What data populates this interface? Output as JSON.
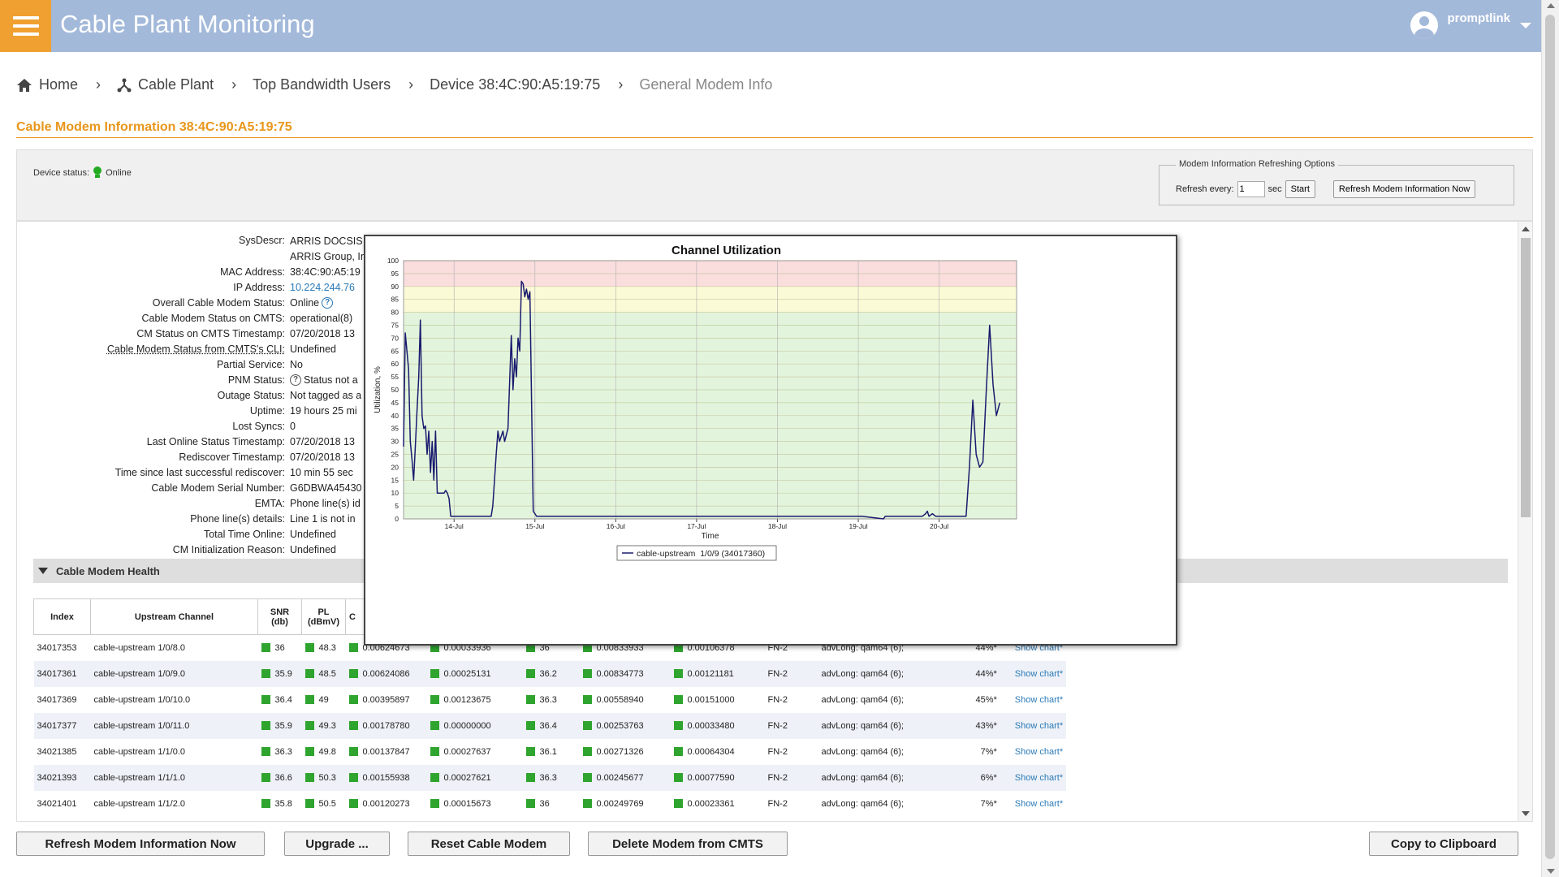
{
  "app": {
    "title": "Cable Plant Monitoring",
    "user": "promptlink"
  },
  "breadcrumb": {
    "home": "Home",
    "cable_plant": "Cable Plant",
    "top_users": "Top Bandwidth Users",
    "device": "Device 38:4C:90:A5:19:75",
    "current": "General Modem Info"
  },
  "section_title": "Cable Modem Information 38:4C:90:A5:19:75",
  "status": {
    "label": "Device status:",
    "value": "Online"
  },
  "refresh_options": {
    "legend": "Modem Information Refreshing Options",
    "every_label": "Refresh every:",
    "every_value": "1",
    "unit": "sec",
    "start_label": "Start",
    "refresh_now_label": "Refresh Modem Information Now"
  },
  "info": [
    {
      "label": "SysDescr:",
      "value": "ARRIS DOCSIS",
      "value2": "ARRIS Group, In"
    },
    {
      "label": "MAC Address:",
      "value": "38:4C:90:A5:19"
    },
    {
      "label": "IP Address:",
      "value": "10.224.244.76"
    },
    {
      "label": "Overall Cable Modem Status:",
      "value": "Online"
    },
    {
      "label": "Cable Modem Status on CMTS:",
      "value": "operational(8)"
    },
    {
      "label": "CM Status on CMTS Timestamp:",
      "value": "07/20/2018 13"
    },
    {
      "label": "Cable Modem Status from CMTS's CLI:",
      "value": "Undefined"
    },
    {
      "label": "Partial Service:",
      "value": "No"
    },
    {
      "label": "PNM Status:",
      "value": "Status not a"
    },
    {
      "label": "Outage Status:",
      "value": "Not tagged as a"
    },
    {
      "label": "Uptime:",
      "value": "19 hours 25 mi"
    },
    {
      "label": "Lost Syncs:",
      "value": "0"
    },
    {
      "label": "Last Online Status Timestamp:",
      "value": "07/20/2018 13"
    },
    {
      "label": "Rediscover Timestamp:",
      "value": "07/20/2018 13"
    },
    {
      "label": "Time since last successful rediscover:",
      "value": "10 min 55 sec"
    },
    {
      "label": "Cable Modem Serial Number:",
      "value": "G6DBWA45430"
    },
    {
      "label": "EMTA:",
      "value": "Phone line(s) id"
    },
    {
      "label": "Phone line(s) details:",
      "value": "Line 1 is not in"
    },
    {
      "label": "Total Time Online:",
      "value": "Undefined"
    },
    {
      "label": "CM Initialization Reason:",
      "value": "Undefined"
    }
  ],
  "health": {
    "title": "Cable Modem Health"
  },
  "upstream_table": {
    "headers": {
      "index": "Index",
      "channel": "Upstream Channel",
      "snr": "SNR",
      "snr_unit": "(db)",
      "pl": "PL",
      "pl_unit": "(dBmV)",
      "c": "C"
    },
    "rows": [
      {
        "index": "34017353",
        "channel": "cable-upstream 1/0/8.0",
        "snr": "36",
        "pl": "48.3",
        "c1": "0.00624673",
        "c2": "0.00033936",
        "c3": "36",
        "c4": "0.00833933",
        "c5": "0.00106378",
        "fn": "FN-2",
        "mod": "advLong: qam64 (6);",
        "util": "44%*",
        "link": "Show chart*"
      },
      {
        "index": "34017361",
        "channel": "cable-upstream 1/0/9.0",
        "snr": "35.9",
        "pl": "48.5",
        "c1": "0.00624086",
        "c2": "0.00025131",
        "c3": "36.2",
        "c4": "0.00834773",
        "c5": "0.00121181",
        "fn": "FN-2",
        "mod": "advLong: qam64 (6);",
        "util": "44%*",
        "link": "Show chart*"
      },
      {
        "index": "34017369",
        "channel": "cable-upstream 1/0/10.0",
        "snr": "36.4",
        "pl": "49",
        "c1": "0.00395897",
        "c2": "0.00123675",
        "c3": "36.3",
        "c4": "0.00558940",
        "c5": "0.00151000",
        "fn": "FN-2",
        "mod": "advLong: qam64 (6);",
        "util": "45%*",
        "link": "Show chart*"
      },
      {
        "index": "34017377",
        "channel": "cable-upstream 1/0/11.0",
        "snr": "35.9",
        "pl": "49.3",
        "c1": "0.00178780",
        "c2": "0.00000000",
        "c3": "36.4",
        "c4": "0.00253763",
        "c5": "0.00033480",
        "fn": "FN-2",
        "mod": "advLong: qam64 (6);",
        "util": "43%*",
        "link": "Show chart*"
      },
      {
        "index": "34021385",
        "channel": "cable-upstream 1/1/0.0",
        "snr": "36.3",
        "pl": "49.8",
        "c1": "0.00137847",
        "c2": "0.00027637",
        "c3": "36.1",
        "c4": "0.00271326",
        "c5": "0.00064304",
        "fn": "FN-2",
        "mod": "advLong: qam64 (6);",
        "util": "7%*",
        "link": "Show chart*"
      },
      {
        "index": "34021393",
        "channel": "cable-upstream 1/1/1.0",
        "snr": "36.6",
        "pl": "50.3",
        "c1": "0.00155938",
        "c2": "0.00027621",
        "c3": "36.3",
        "c4": "0.00245677",
        "c5": "0.00077590",
        "fn": "FN-2",
        "mod": "advLong: qam64 (6);",
        "util": "6%*",
        "link": "Show chart*"
      },
      {
        "index": "34021401",
        "channel": "cable-upstream 1/1/2.0",
        "snr": "35.8",
        "pl": "50.5",
        "c1": "0.00120273",
        "c2": "0.00015673",
        "c3": "36",
        "c4": "0.00249769",
        "c5": "0.00023361",
        "fn": "FN-2",
        "mod": "advLong: qam64 (6);",
        "util": "7%*",
        "link": "Show chart*"
      }
    ]
  },
  "buttons": {
    "refresh": "Refresh Modem Information Now",
    "upgrade": "Upgrade ...",
    "reset": "Reset Cable Modem",
    "delete": "Delete Modem from CMTS",
    "copy": "Copy to Clipboard"
  },
  "chart_data": {
    "type": "line",
    "title": "Channel Utilization",
    "xlabel": "Time",
    "ylabel": "Utilization, %",
    "ylim": [
      0,
      100
    ],
    "yticks": [
      0,
      5,
      10,
      15,
      20,
      25,
      30,
      35,
      40,
      45,
      50,
      55,
      60,
      65,
      70,
      75,
      80,
      85,
      90,
      95,
      100
    ],
    "xlim": [
      "2018-07-13 09:00",
      "2018-07-20 23:00"
    ],
    "xticks": [
      {
        "date": "2018-07-14",
        "label": "14-Jul"
      },
      {
        "date": "2018-07-15",
        "label": "15-Jul"
      },
      {
        "date": "2018-07-16",
        "label": "16-Jul"
      },
      {
        "date": "2018-07-17",
        "label": "17-Jul"
      },
      {
        "date": "2018-07-18",
        "label": "18-Jul"
      },
      {
        "date": "2018-07-19",
        "label": "19-Jul"
      },
      {
        "date": "2018-07-20",
        "label": "20-Jul"
      }
    ],
    "bands": [
      {
        "from": 0,
        "to": 80,
        "color": "#e2f5dc"
      },
      {
        "from": 80,
        "to": 90,
        "color": "#fbfad6"
      },
      {
        "from": 90,
        "to": 100,
        "color": "#fadddd"
      }
    ],
    "grid": true,
    "legend_position": "bottom",
    "series": [
      {
        "name": "cable-upstream  1/0/9 (34017360)",
        "color": "#1a1a6e",
        "points": [
          [
            "2018-07-13 09:00",
            28
          ],
          [
            "2018-07-13 09:30",
            72
          ],
          [
            "2018-07-13 10:30",
            58
          ],
          [
            "2018-07-13 11:00",
            30
          ],
          [
            "2018-07-13 11:30",
            23
          ],
          [
            "2018-07-13 12:00",
            15
          ],
          [
            "2018-07-13 12:30",
            28
          ],
          [
            "2018-07-13 13:00",
            42
          ],
          [
            "2018-07-13 13:30",
            55
          ],
          [
            "2018-07-13 14:00",
            77
          ],
          [
            "2018-07-13 14:30",
            40
          ],
          [
            "2018-07-13 15:00",
            35
          ],
          [
            "2018-07-13 15:30",
            36
          ],
          [
            "2018-07-13 16:00",
            25
          ],
          [
            "2018-07-13 16:30",
            34
          ],
          [
            "2018-07-13 17:00",
            18
          ],
          [
            "2018-07-13 17:30",
            30
          ],
          [
            "2018-07-13 18:00",
            15
          ],
          [
            "2018-07-13 18:30",
            34
          ],
          [
            "2018-07-13 19:00",
            10
          ],
          [
            "2018-07-13 21:00",
            10
          ],
          [
            "2018-07-13 21:30",
            11
          ],
          [
            "2018-07-13 22:00",
            10
          ],
          [
            "2018-07-13 22:30",
            8
          ],
          [
            "2018-07-13 23:00",
            1
          ],
          [
            "2018-07-14 11:00",
            1
          ],
          [
            "2018-07-14 11:30",
            5
          ],
          [
            "2018-07-14 12:30",
            25
          ],
          [
            "2018-07-14 13:00",
            34
          ],
          [
            "2018-07-14 13:30",
            30
          ],
          [
            "2018-07-14 14:30",
            34
          ],
          [
            "2018-07-14 15:00",
            30
          ],
          [
            "2018-07-14 16:00",
            35
          ],
          [
            "2018-07-14 17:00",
            71
          ],
          [
            "2018-07-14 17:30",
            50
          ],
          [
            "2018-07-14 18:00",
            62
          ],
          [
            "2018-07-14 18:30",
            55
          ],
          [
            "2018-07-14 19:00",
            70
          ],
          [
            "2018-07-14 19:30",
            65
          ],
          [
            "2018-07-14 20:00",
            92
          ],
          [
            "2018-07-14 20:30",
            91
          ],
          [
            "2018-07-14 21:00",
            86
          ],
          [
            "2018-07-14 21:30",
            89
          ],
          [
            "2018-07-14 22:00",
            85
          ],
          [
            "2018-07-14 22:30",
            88
          ],
          [
            "2018-07-14 23:30",
            3
          ],
          [
            "2018-07-15 00:30",
            1
          ],
          [
            "2018-07-18 13:00",
            1
          ],
          [
            "2018-07-19 01:00",
            1
          ],
          [
            "2018-07-19 07:30",
            0
          ],
          [
            "2018-07-19 08:00",
            1
          ],
          [
            "2018-07-19 19:00",
            1
          ],
          [
            "2018-07-19 20:00",
            2
          ],
          [
            "2018-07-19 20:30",
            3
          ],
          [
            "2018-07-19 21:00",
            1
          ],
          [
            "2018-07-19 22:00",
            2
          ],
          [
            "2018-07-19 23:00",
            1
          ],
          [
            "2018-07-20 08:00",
            1
          ],
          [
            "2018-07-20 09:00",
            20
          ],
          [
            "2018-07-20 10:00",
            46
          ],
          [
            "2018-07-20 11:00",
            25
          ],
          [
            "2018-07-20 12:00",
            20
          ],
          [
            "2018-07-20 13:00",
            22
          ],
          [
            "2018-07-20 14:00",
            50
          ],
          [
            "2018-07-20 15:00",
            75
          ],
          [
            "2018-07-20 16:00",
            52
          ],
          [
            "2018-07-20 17:00",
            40
          ],
          [
            "2018-07-20 18:00",
            45
          ]
        ]
      }
    ]
  },
  "colors": {
    "header": "#a3b9da",
    "accent": "#e8961a",
    "status_green": "#2fa42f",
    "link": "#2a7ab8"
  },
  "icons": {
    "menu": "hamburger-icon",
    "user": "user-avatar-icon",
    "home": "home-icon",
    "cable_plant": "network-icon",
    "status": "bulb-icon",
    "help": "help-icon",
    "collapse": "caret-down-icon"
  }
}
